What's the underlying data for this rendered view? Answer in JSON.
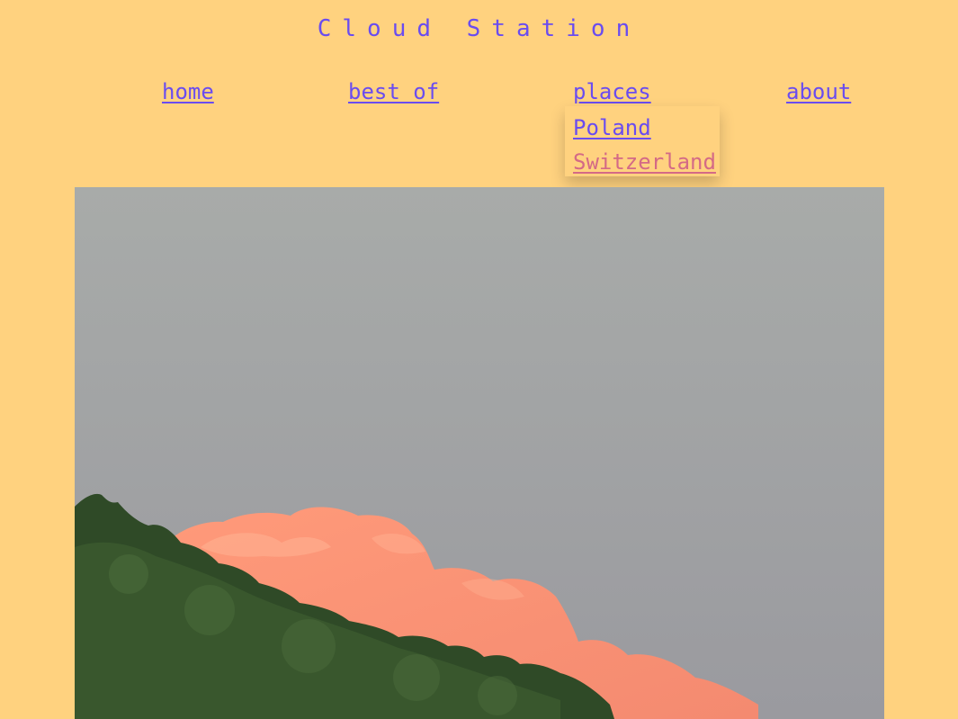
{
  "site": {
    "title": "Cloud Station"
  },
  "nav": {
    "items": [
      {
        "label": "home"
      },
      {
        "label": "best of"
      },
      {
        "label": "places"
      },
      {
        "label": "about"
      }
    ],
    "places_dropdown": [
      {
        "label": "Poland"
      },
      {
        "label": "Switzerland"
      }
    ]
  },
  "photo": {
    "description_icon": "cloud-photo"
  },
  "colors": {
    "background": "#ffd27f",
    "link": "#6a4cf0",
    "link_hover": "#d46a86"
  }
}
